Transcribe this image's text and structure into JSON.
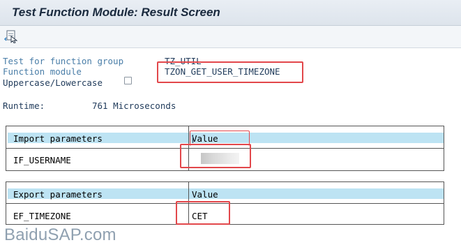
{
  "window": {
    "title": "Test Function Module: Result Screen"
  },
  "toolbar": {
    "icon": "back-to-screen-icon"
  },
  "form": {
    "test_for_label": "Test for function group",
    "test_for_value": "TZ_UTIL",
    "function_module_label": "Function module",
    "function_module_value": "TZON_GET_USER_TIMEZONE",
    "case_label": "Uppercase/Lowercase",
    "case_checked": false,
    "runtime_label": "Runtime:",
    "runtime_value": "761 Microseconds"
  },
  "import_table": {
    "header_left": "Import parameters",
    "header_right": "Value",
    "rows": [
      {
        "name": "IF_USERNAME",
        "value": ""
      }
    ]
  },
  "export_table": {
    "header_left": "Export parameters",
    "header_right": "Value",
    "rows": [
      {
        "name": "EF_TIMEZONE",
        "value": "CET"
      }
    ]
  },
  "watermark": "BaiduSAP.com",
  "colors": {
    "highlight": "#e2474b",
    "header_fill": "#bde3f3",
    "label_blue": "#4a7ea8"
  }
}
